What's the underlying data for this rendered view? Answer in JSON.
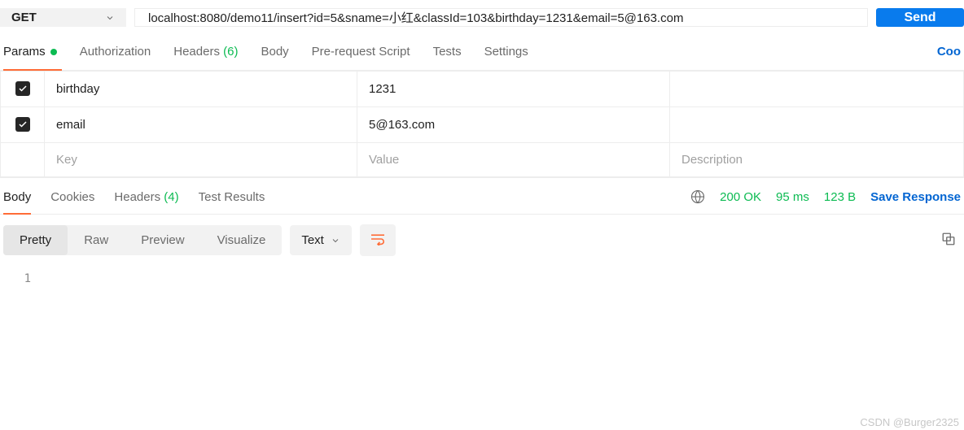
{
  "request": {
    "method": "GET",
    "url": "localhost:8080/demo11/insert?id=5&sname=小红&classId=103&birthday=1231&email=5@163.com",
    "send_label": "Send"
  },
  "req_tabs": {
    "params": "Params",
    "authorization": "Authorization",
    "headers_label": "Headers",
    "headers_count": "(6)",
    "body": "Body",
    "prerequest": "Pre-request Script",
    "tests": "Tests",
    "settings": "Settings",
    "cookies_link": "Coo"
  },
  "params": {
    "rows": [
      {
        "key": "birthday",
        "value": "1231"
      },
      {
        "key": "email",
        "value": "5@163.com"
      }
    ],
    "placeholder": {
      "key": "Key",
      "value": "Value",
      "desc": "Description"
    }
  },
  "resp_tabs": {
    "body": "Body",
    "cookies": "Cookies",
    "headers_label": "Headers",
    "headers_count": "(4)",
    "tests": "Test Results"
  },
  "status": {
    "code": "200 OK",
    "time": "95 ms",
    "size": "123 B",
    "save": "Save Response"
  },
  "view": {
    "pretty": "Pretty",
    "raw": "Raw",
    "preview": "Preview",
    "visualize": "Visualize",
    "type": "Text"
  },
  "body": {
    "lines": [
      {
        "n": "1",
        "text": ""
      }
    ]
  },
  "watermark": "CSDN @Burger2325"
}
